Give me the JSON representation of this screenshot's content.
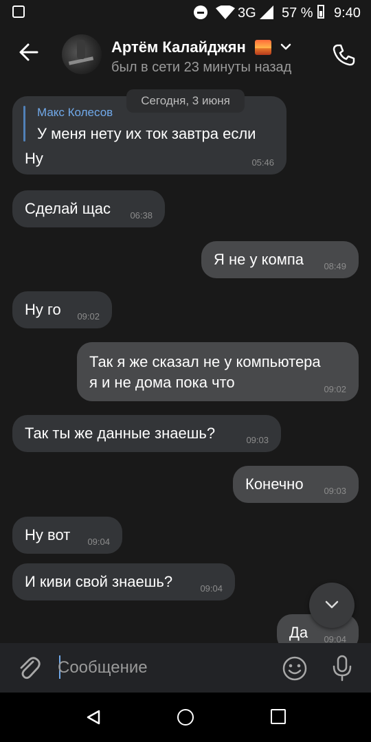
{
  "status_bar": {
    "network": "3G",
    "battery_percent": "57 %",
    "time": "9:40",
    "icons": [
      "gallery-icon",
      "dnd-icon",
      "wifi-icon",
      "signal-icon",
      "battery-icon"
    ]
  },
  "header": {
    "contact_name": "Артём Калайджян",
    "last_seen": "был в сети 23 минуты назад",
    "icons": [
      "back-icon",
      "avatar",
      "sunset-icon",
      "chevron-down-icon",
      "call-icon"
    ]
  },
  "date_label": "Сегодня, 3 июня",
  "messages": [
    {
      "dir": "in",
      "reply_to": "Макс Колесов",
      "reply_text": "У меня нету их ток завтра если",
      "text": "Ну",
      "time": "05:46"
    },
    {
      "dir": "in",
      "text": "Сделай щас",
      "time": "06:38"
    },
    {
      "dir": "out",
      "text": "Я не у компа",
      "time": "08:49"
    },
    {
      "dir": "in",
      "text": "Ну го",
      "time": "09:02"
    },
    {
      "dir": "out",
      "lines": [
        "Так я же сказал не у компьютера",
        "я и не дома пока что"
      ],
      "time": "09:02"
    },
    {
      "dir": "in",
      "text": "Так ты же данные знаешь?",
      "time": "09:03"
    },
    {
      "dir": "out",
      "text": "Конечно",
      "time": "09:03"
    },
    {
      "dir": "in",
      "text": "Ну вот",
      "time": "09:04"
    },
    {
      "dir": "in",
      "text": "И киви свой знаешь?",
      "time": "09:04"
    },
    {
      "dir": "out",
      "text": "Да",
      "time": "09:04"
    }
  ],
  "composer": {
    "placeholder": "Сообщение",
    "icons": [
      "attach-icon",
      "emoji-icon",
      "mic-icon"
    ]
  },
  "nav": {
    "icons": [
      "nav-back-icon",
      "nav-home-icon",
      "nav-recents-icon"
    ]
  },
  "colors": {
    "background": "#191919",
    "incoming_bubble": "#333538",
    "outgoing_bubble": "#48494b",
    "accent": "#71aaeb"
  }
}
